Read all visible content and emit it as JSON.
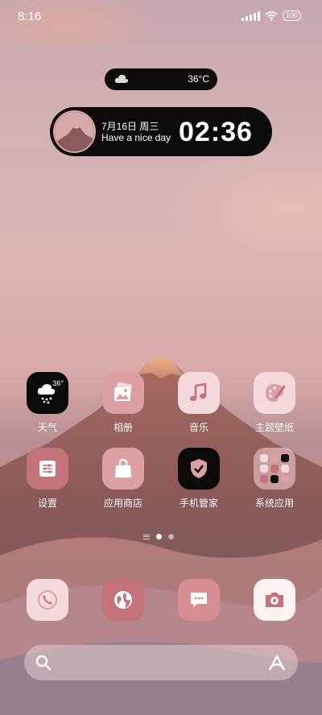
{
  "status_bar": {
    "time": "8:16",
    "battery": "100"
  },
  "weather_widget": {
    "temperature": "36°C",
    "icon": "cloud-icon"
  },
  "clock_widget": {
    "date": "7月16日 周三",
    "greeting": "Have a nice day",
    "time": "02:36"
  },
  "apps": [
    {
      "name": "weather",
      "label": "天气",
      "icon": "weather-rain-icon",
      "temp": "36°"
    },
    {
      "name": "gallery",
      "label": "相册",
      "icon": "photo-icon"
    },
    {
      "name": "music",
      "label": "音乐",
      "icon": "music-note-icon"
    },
    {
      "name": "themes",
      "label": "主题壁纸",
      "icon": "palette-icon"
    },
    {
      "name": "settings",
      "label": "设置",
      "icon": "sliders-icon"
    },
    {
      "name": "app-store",
      "label": "应用商店",
      "icon": "shopping-bag-icon"
    },
    {
      "name": "security",
      "label": "手机管家",
      "icon": "shield-check-icon"
    },
    {
      "name": "system-apps",
      "label": "系统应用",
      "icon": "folder-icon"
    }
  ],
  "page_indicator": {
    "pages": 2,
    "active": 0
  },
  "dock": [
    {
      "name": "phone",
      "icon": "phone-icon"
    },
    {
      "name": "browser",
      "icon": "globe-icon"
    },
    {
      "name": "messages",
      "icon": "chat-bubble-icon"
    },
    {
      "name": "camera",
      "icon": "camera-icon"
    }
  ],
  "search_bar": {
    "search_icon": "search-icon",
    "assistant_icon": "assistant-icon"
  },
  "colors": {
    "widget_bg": "#0c0c0c",
    "icon_pink_light": "#f4dadc",
    "icon_pink_mid": "#dca0a4",
    "icon_pink_deep": "#c4737a"
  }
}
